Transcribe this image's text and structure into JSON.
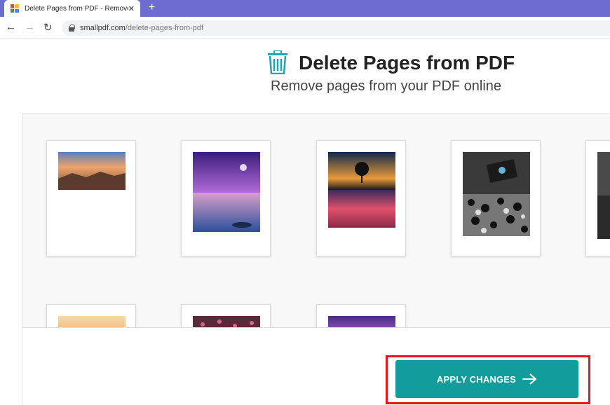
{
  "browser": {
    "tab_title": "Delete Pages from PDF - Remove",
    "url_domain": "smallpdf.com",
    "url_path": "/delete-pages-from-pdf"
  },
  "page": {
    "title": "Delete Pages from PDF",
    "subtitle": "Remove pages from your PDF online"
  },
  "footer": {
    "apply_label": "APPLY CHANGES"
  },
  "colors": {
    "accent": "#139c9c",
    "highlight": "#e8141e",
    "tabbar": "#6d6dd1"
  }
}
